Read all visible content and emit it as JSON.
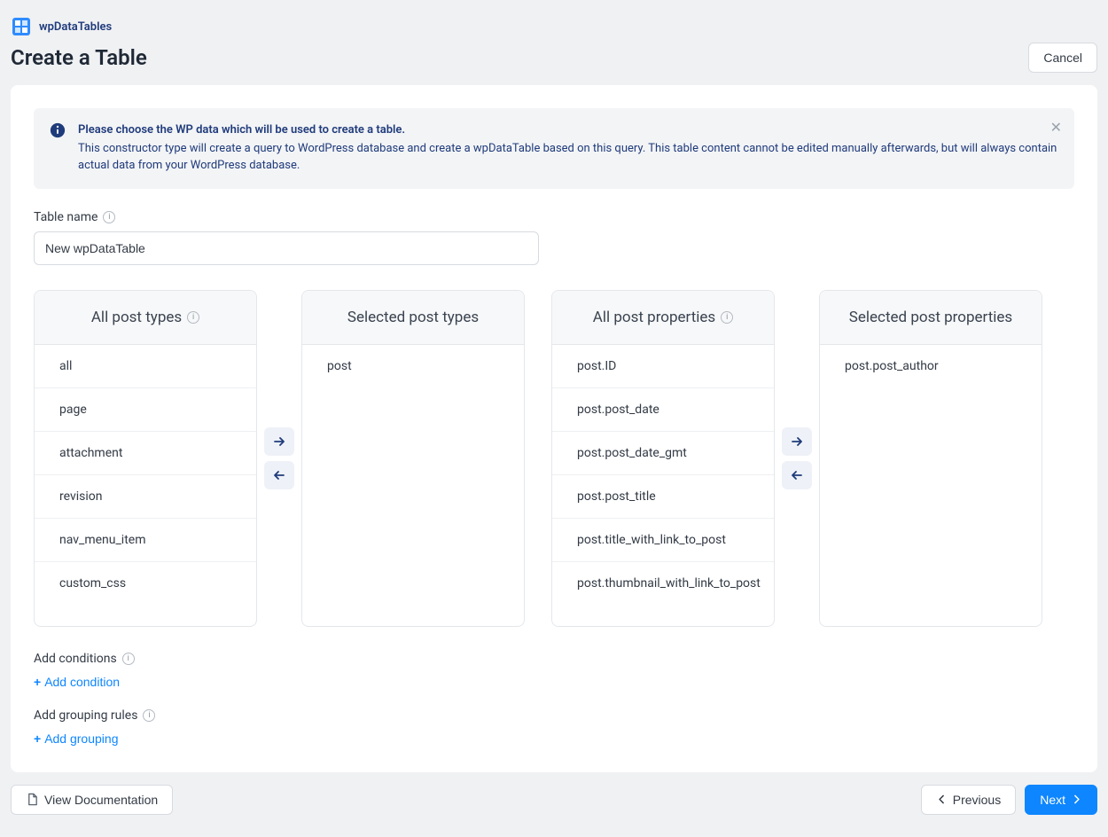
{
  "brand": {
    "name": "wpDataTables"
  },
  "header": {
    "page_title": "Create a Table",
    "cancel_label": "Cancel"
  },
  "alert": {
    "title": "Please choose the WP data which will be used to create a table.",
    "body": "This constructor type will create a query to WordPress database and create a wpDataTable based on this query. This table content cannot be edited manually afterwards, but will always contain actual data from your WordPress database."
  },
  "table_name": {
    "label": "Table name",
    "value": "New wpDataTable"
  },
  "pickers": {
    "all_post_types": {
      "title": "All post types",
      "items": [
        "all",
        "page",
        "attachment",
        "revision",
        "nav_menu_item",
        "custom_css"
      ]
    },
    "selected_post_types": {
      "title": "Selected post types",
      "items": [
        "post"
      ]
    },
    "all_post_properties": {
      "title": "All post properties",
      "items": [
        "post.ID",
        "post.post_date",
        "post.post_date_gmt",
        "post.post_title",
        "post.title_with_link_to_post",
        "post.thumbnail_with_link_to_post"
      ]
    },
    "selected_post_properties": {
      "title": "Selected post properties",
      "items": [
        "post.post_author"
      ]
    }
  },
  "conditions": {
    "label": "Add conditions",
    "add_label": "Add condition"
  },
  "grouping": {
    "label": "Add grouping rules",
    "add_label": "Add grouping"
  },
  "footer": {
    "docs_label": "View Documentation",
    "prev_label": "Previous",
    "next_label": "Next"
  }
}
